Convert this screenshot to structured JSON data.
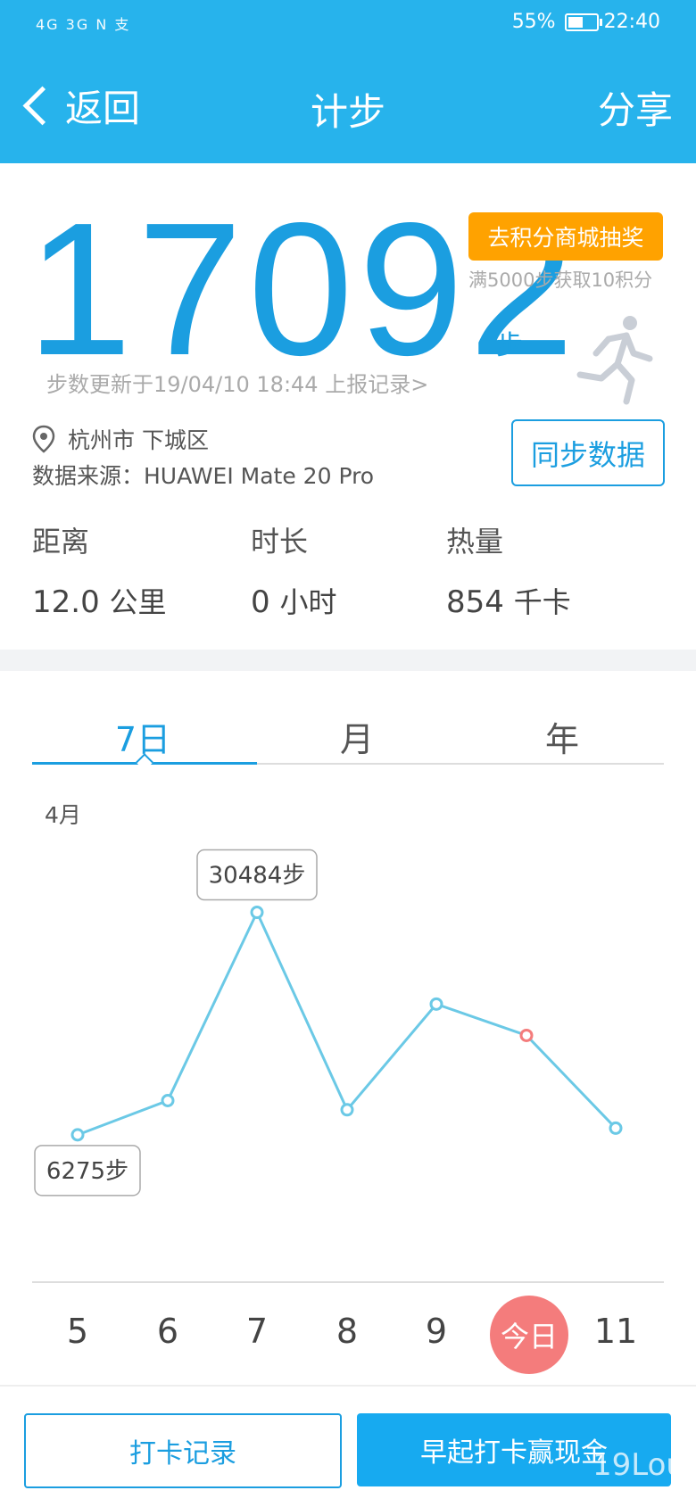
{
  "status_bar": {
    "network": "4G 3G N 支",
    "battery": "55%",
    "time": "22:40"
  },
  "header": {
    "back_label": "返回",
    "title": "计步",
    "share_label": "分享"
  },
  "steps": {
    "count": "17092",
    "unit": "步",
    "lottery_button": "去积分商城抽奖",
    "lottery_note": "满5000步获取10积分",
    "update_text": "步数更新于19/04/10 18:44 上报记录>"
  },
  "info": {
    "location": "杭州市 下城区",
    "source": "数据来源：HUAWEI Mate 20 Pro",
    "sync_button": "同步数据"
  },
  "metrics": [
    {
      "label": "距离",
      "value": "12.0",
      "unit": "公里"
    },
    {
      "label": "时长",
      "value": "0",
      "unit": "小时"
    },
    {
      "label": "热量",
      "value": "854",
      "unit": "千卡"
    }
  ],
  "tabs": [
    {
      "label": "7日",
      "active": true
    },
    {
      "label": "月",
      "active": false
    },
    {
      "label": "年",
      "active": false
    }
  ],
  "chart": {
    "month_label": "4月",
    "max_tooltip": "30484步",
    "min_tooltip": "6275步"
  },
  "chart_data": {
    "type": "line",
    "x": [
      "5",
      "6",
      "7",
      "8",
      "9",
      "今日",
      "11"
    ],
    "values": [
      6275,
      10000,
      30484,
      9000,
      20500,
      17092,
      7000
    ],
    "highlight_index": 5,
    "colors": {
      "line": "#6bc9e6",
      "highlight": "#f47c7c"
    }
  },
  "buttons": {
    "checkin_record": "打卡记录",
    "early_checkin": "早起打卡赢现金"
  },
  "watermark": "19Lou",
  "colors": {
    "header_bg": "#27b3ec",
    "accent": "#1b9ee0",
    "orange": "#ffa200",
    "today": "#f47c7c"
  }
}
